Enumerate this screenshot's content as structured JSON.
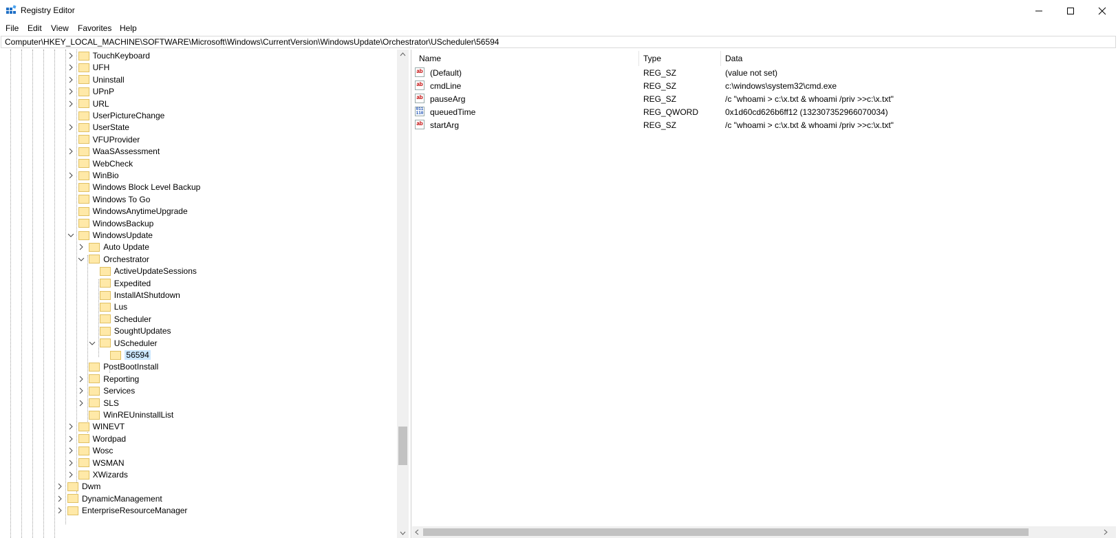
{
  "window": {
    "title": "Registry Editor",
    "minimize_icon": "minimize-icon",
    "maximize_icon": "maximize-icon",
    "close_icon": "close-icon"
  },
  "menu": {
    "file": "File",
    "edit": "Edit",
    "view": "View",
    "favorites": "Favorites",
    "help": "Help"
  },
  "address": "Computer\\HKEY_LOCAL_MACHINE\\SOFTWARE\\Microsoft\\Windows\\CurrentVersion\\WindowsUpdate\\Orchestrator\\UScheduler\\56594",
  "tree": [
    "TouchKeyboard",
    "UFH",
    "Uninstall",
    "UPnP",
    "URL",
    "UserPictureChange",
    "UserState",
    "VFUProvider",
    "WaaSAssessment",
    "WebCheck",
    "WinBio",
    "Windows Block Level Backup",
    "Windows To Go",
    "WindowsAnytimeUpgrade",
    "WindowsBackup",
    "WindowsUpdate",
    "Auto Update",
    "Orchestrator",
    "ActiveUpdateSessions",
    "Expedited",
    "InstallAtShutdown",
    "Lus",
    "Scheduler",
    "SoughtUpdates",
    "UScheduler",
    "56594",
    "PostBootInstall",
    "Reporting",
    "Services",
    "SLS",
    "WinREUninstallList",
    "WINEVT",
    "Wordpad",
    "Wosc",
    "WSMAN",
    "XWizards",
    "Dwm",
    "DynamicManagement",
    "EnterpriseResourceManager"
  ],
  "columns": {
    "name": "Name",
    "type": "Type",
    "data": "Data"
  },
  "values": [
    {
      "icon": "string-value-icon",
      "name": "(Default)",
      "type": "REG_SZ",
      "data": "(value not set)"
    },
    {
      "icon": "string-value-icon",
      "name": "cmdLine",
      "type": "REG_SZ",
      "data": "c:\\windows\\system32\\cmd.exe"
    },
    {
      "icon": "string-value-icon",
      "name": "pauseArg",
      "type": "REG_SZ",
      "data": "/c \"whoami > c:\\x.txt & whoami /priv >>c:\\x.txt\""
    },
    {
      "icon": "binary-value-icon",
      "name": "queuedTime",
      "type": "REG_QWORD",
      "data": "0x1d60cd626b6ff12 (132307352966070034)"
    },
    {
      "icon": "string-value-icon",
      "name": "startArg",
      "type": "REG_SZ",
      "data": "/c \"whoami > c:\\x.txt & whoami /priv >>c:\\x.txt\""
    }
  ],
  "icons": {
    "string": "ab",
    "binary": "011\n110"
  }
}
